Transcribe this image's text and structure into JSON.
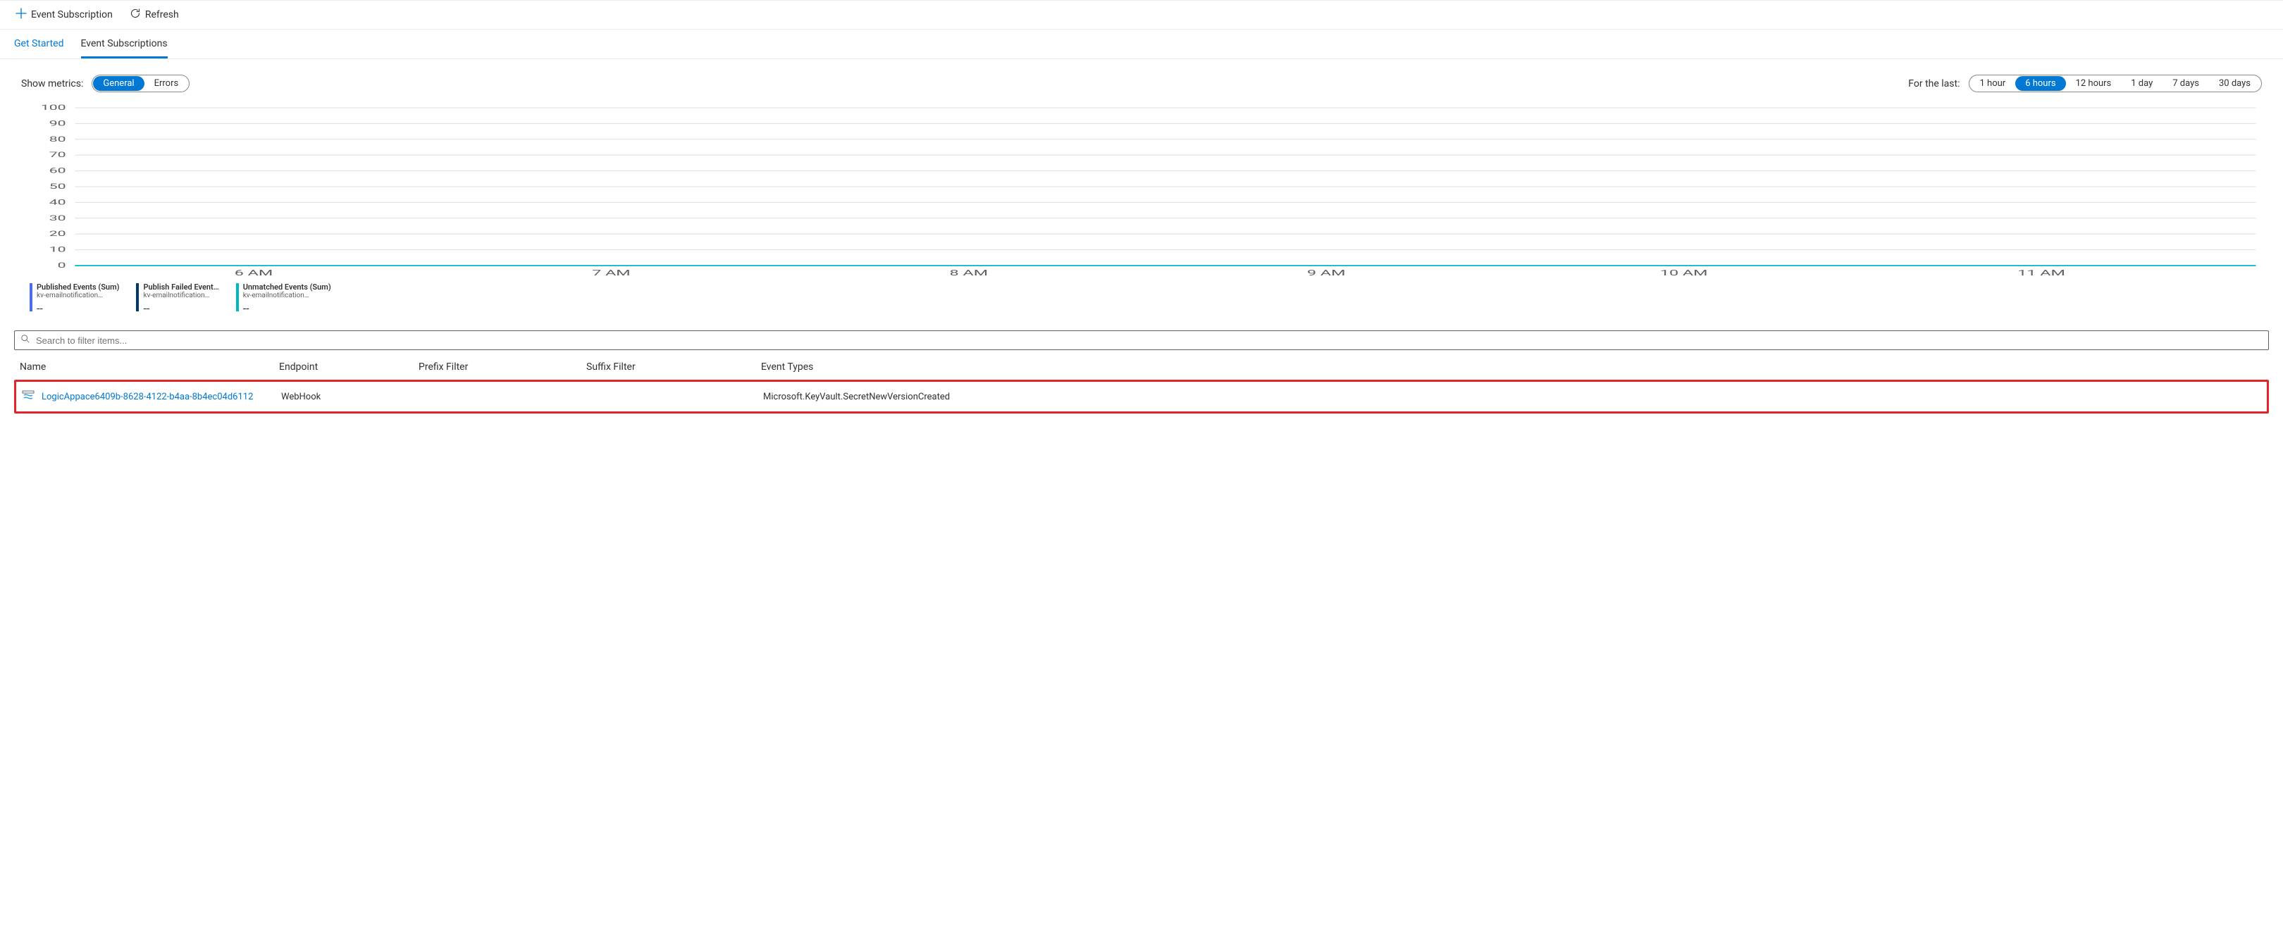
{
  "toolbar": {
    "event_subscription_label": "Event Subscription",
    "refresh_label": "Refresh"
  },
  "tabs": {
    "get_started": "Get Started",
    "event_subscriptions": "Event Subscriptions"
  },
  "metrics": {
    "label": "Show metrics:",
    "options": {
      "general": "General",
      "errors": "Errors"
    },
    "selected": "general"
  },
  "timerange": {
    "label": "For the last:",
    "options": {
      "h1": "1 hour",
      "h6": "6 hours",
      "h12": "12 hours",
      "d1": "1 day",
      "d7": "7 days",
      "d30": "30 days"
    },
    "selected": "h6"
  },
  "chart_data": {
    "type": "line",
    "ylabel": "",
    "xlabel": "",
    "ylim": [
      0,
      100
    ],
    "y_ticks": [
      0,
      10,
      20,
      30,
      40,
      50,
      60,
      70,
      80,
      90,
      100
    ],
    "x_categories": [
      "6 AM",
      "7 AM",
      "8 AM",
      "9 AM",
      "10 AM",
      "11 AM"
    ],
    "series": [
      {
        "name": "Published Events (Sum)",
        "source": "kv-emailnotification…",
        "color": "#4f6bed",
        "values": [
          0,
          0,
          0,
          0,
          0,
          0
        ],
        "display_value": "--"
      },
      {
        "name": "Publish Failed Event…",
        "source": "kv-emailnotification…",
        "color": "#003a6c",
        "values": [
          0,
          0,
          0,
          0,
          0,
          0
        ],
        "display_value": "--"
      },
      {
        "name": "Unmatched Events (Sum)",
        "source": "kv-emailnotification…",
        "color": "#00b7c3",
        "values": [
          0,
          0,
          0,
          0,
          0,
          0
        ],
        "display_value": "--"
      }
    ]
  },
  "search": {
    "placeholder": "Search to filter items..."
  },
  "table": {
    "headers": {
      "name": "Name",
      "endpoint": "Endpoint",
      "prefix": "Prefix Filter",
      "suffix": "Suffix Filter",
      "eventtypes": "Event Types"
    },
    "rows": [
      {
        "name": "LogicAppace6409b-8628-4122-b4aa-8b4ec04d6112",
        "endpoint": "WebHook",
        "prefix": "",
        "suffix": "",
        "eventtypes": "Microsoft.KeyVault.SecretNewVersionCreated"
      }
    ]
  }
}
